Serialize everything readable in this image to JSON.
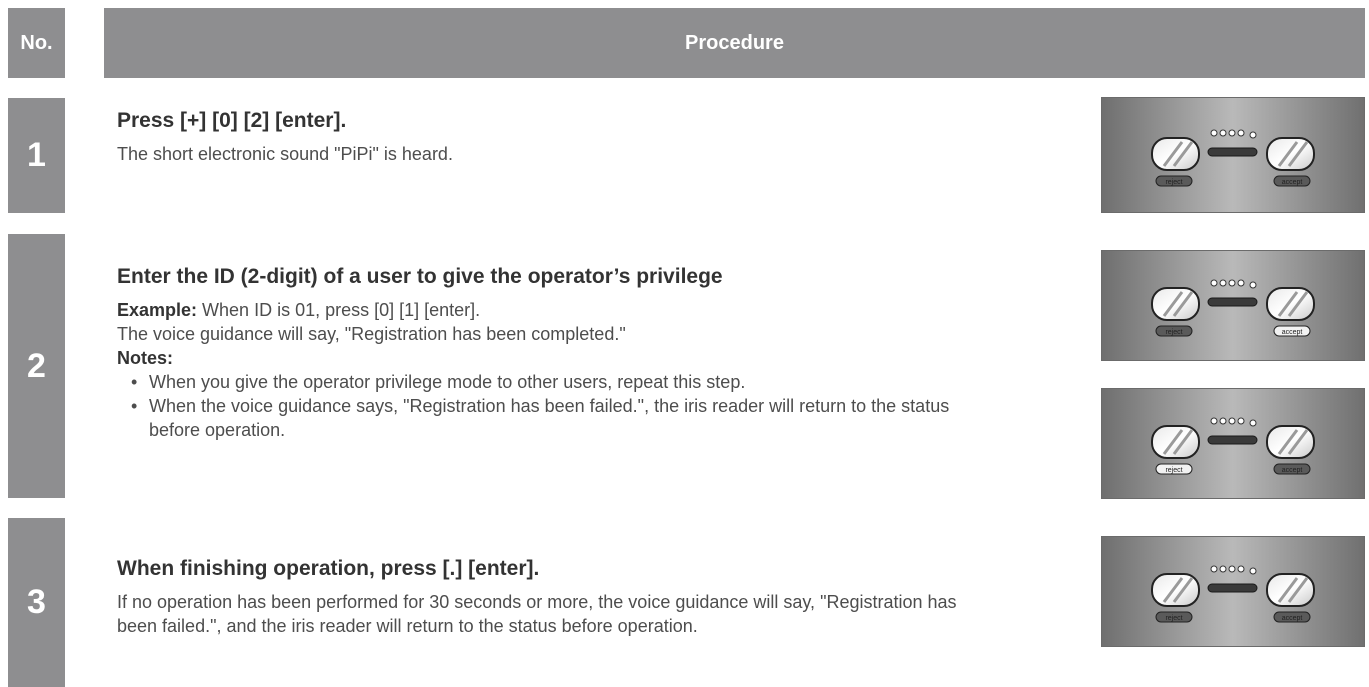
{
  "header": {
    "no_label": "No.",
    "procedure_label": "Procedure"
  },
  "steps": [
    {
      "number": "1",
      "title": "Press [+] [0] [2] [enter].",
      "text": "The short electronic sound \"PiPi\" is heard."
    },
    {
      "number": "2",
      "title": "Enter the ID (2-digit) of a user to give the operator’s privilege",
      "example_label": "Example:",
      "example_text": " When ID is 01, press [0] [1] [enter].",
      "text": "The voice guidance will say, \"Registration has been completed.\"",
      "notes_label": "Notes:",
      "notes": [
        "When you give the operator privilege mode to other users, repeat this step.",
        "When the voice guidance says, \"Registration has been failed.\", the iris reader will return to the status before operation."
      ]
    },
    {
      "number": "3",
      "title": "When finishing operation, press [.] [enter].",
      "text": "If no operation has been performed for 30 seconds or more, the voice guidance will say, \"Registration has been failed.\", and the iris reader will return to the status before operation."
    }
  ],
  "panels": [
    {
      "reject_label": "reject",
      "accept_label": "accept",
      "lit": "none"
    },
    {
      "reject_label": "reject",
      "accept_label": "accept",
      "lit": "accept"
    },
    {
      "reject_label": "reject",
      "accept_label": "accept",
      "lit": "reject"
    },
    {
      "reject_label": "reject",
      "accept_label": "accept",
      "lit": "none"
    }
  ],
  "colors": {
    "header_bg": "#8e8e90",
    "lamp_off": "#5a5a5a",
    "lamp_on": "#f2f2f2"
  }
}
